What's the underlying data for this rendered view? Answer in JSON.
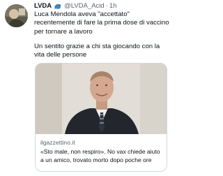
{
  "tweet": {
    "display_name": "LVDA",
    "emoji_icon": "dolphin-icon",
    "handle": "@LVDA_Acid",
    "separator": "·",
    "time": "1h",
    "paragraphs": [
      "Luca Mendola aveva \"accettato\" recentemente di fare la prima dose di vaccino per tornare a lavoro",
      "Un sentito grazie a chi sta giocando con la vita delle persone"
    ]
  },
  "card": {
    "domain": "ilgazzettino.it",
    "title": "«Sto male, non respiro». No vax chiede aiuto a un amico, trovato morto dopo poche ore"
  },
  "colors": {
    "text_primary": "#0f1419",
    "text_secondary": "#536471",
    "card_border": "#cfd9de",
    "background": "#ffffff"
  }
}
